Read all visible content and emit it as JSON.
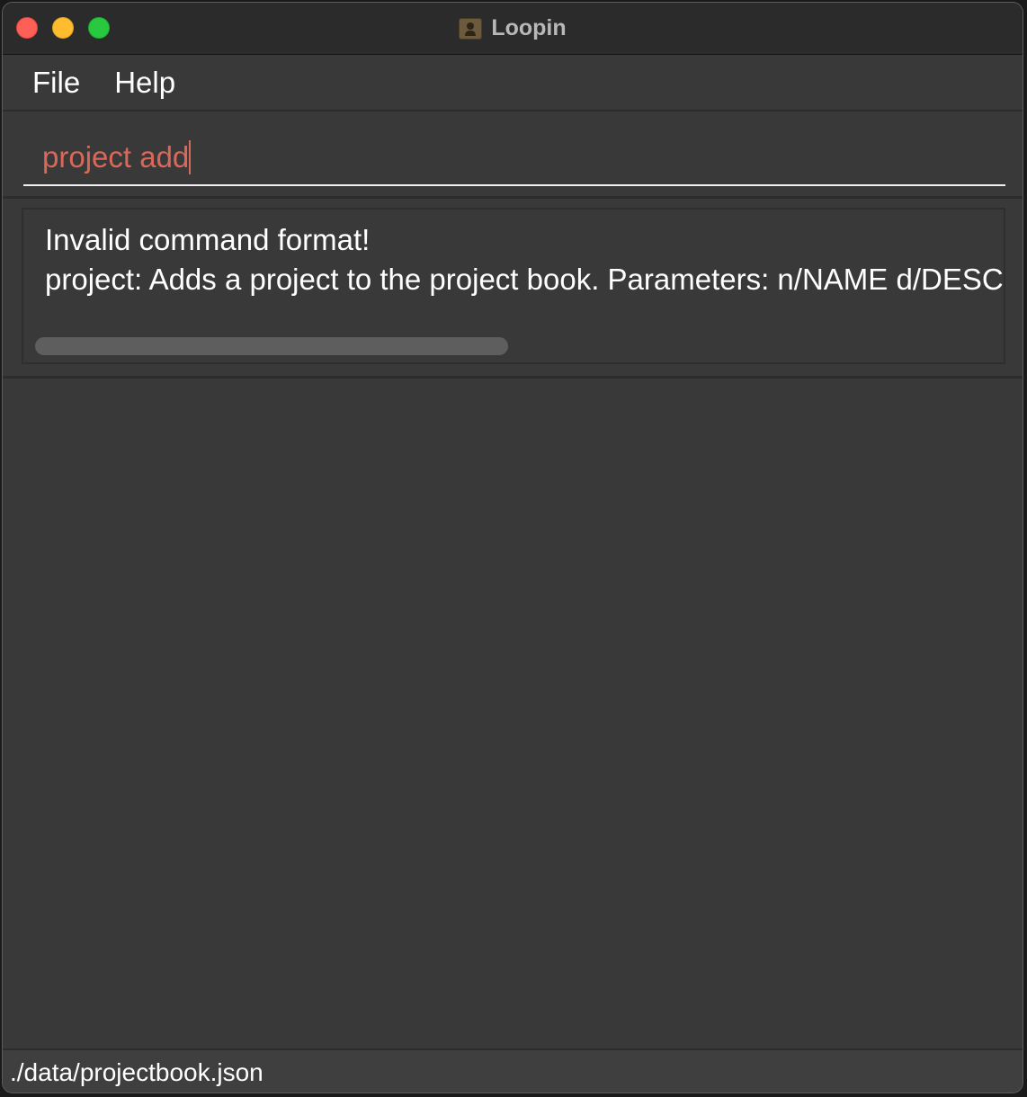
{
  "window": {
    "title": "Loopin"
  },
  "menu": {
    "items": [
      {
        "label": "File"
      },
      {
        "label": "Help"
      }
    ]
  },
  "command": {
    "value": "project add",
    "text_color": "#d9685a"
  },
  "result": {
    "line1": "Invalid command format!",
    "line2": "project: Adds a project to the project book. Parameters: n/NAME d/DESCR"
  },
  "status": {
    "file_path": "./data/projectbook.json"
  },
  "colors": {
    "background": "#393939",
    "titlebar": "#2b2b2b",
    "close": "#fe5f57",
    "minimize": "#febc2e",
    "maximize": "#28c840"
  }
}
